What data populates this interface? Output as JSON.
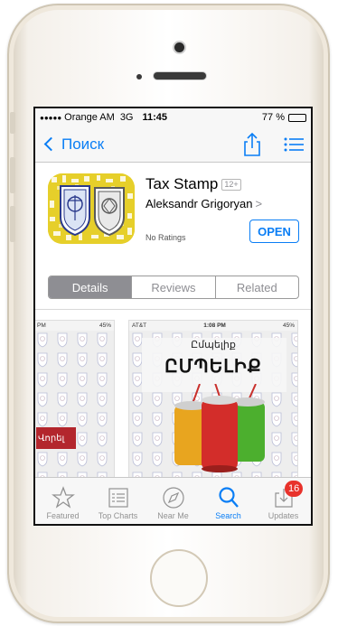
{
  "status_bar": {
    "signal": "●●●●●",
    "carrier": "Orange AM",
    "network": "3G",
    "time": "11:45",
    "battery": "77 %",
    "battery_level": 0.77
  },
  "nav": {
    "back_label": "Поиск",
    "icons": [
      "share-icon",
      "list-icon"
    ],
    "accent": "#0a7ef5"
  },
  "app": {
    "name": "Tax Stamp",
    "age_rating": "12+",
    "developer": "Aleksandr Grigoryan",
    "developer_chevron": ">",
    "ratings": "No Ratings",
    "open_label": "OPEN"
  },
  "segments": [
    {
      "label": "Details",
      "active": true
    },
    {
      "label": "Reviews",
      "active": false
    },
    {
      "label": "Related",
      "active": false
    }
  ],
  "screenshots": {
    "left": {
      "status_left": "PM",
      "status_right": "45%",
      "button_text": "Վորել"
    },
    "right": {
      "status_left": "AT&T",
      "status_time": "1:08 PM",
      "status_right": "45%",
      "heading_small": "Ըմպելիք",
      "heading_large": "ԸՄՊԵԼԻՔ"
    }
  },
  "tab_bar": {
    "tabs": [
      {
        "label": "Featured",
        "icon": "star-icon",
        "active": false
      },
      {
        "label": "Top Charts",
        "icon": "list-icon",
        "active": false
      },
      {
        "label": "Near Me",
        "icon": "compass-icon",
        "active": false
      },
      {
        "label": "Search",
        "icon": "search-icon",
        "active": true
      },
      {
        "label": "Updates",
        "icon": "download-icon",
        "active": false
      }
    ],
    "updates_badge": "16",
    "badge_color": "#e8322b"
  }
}
